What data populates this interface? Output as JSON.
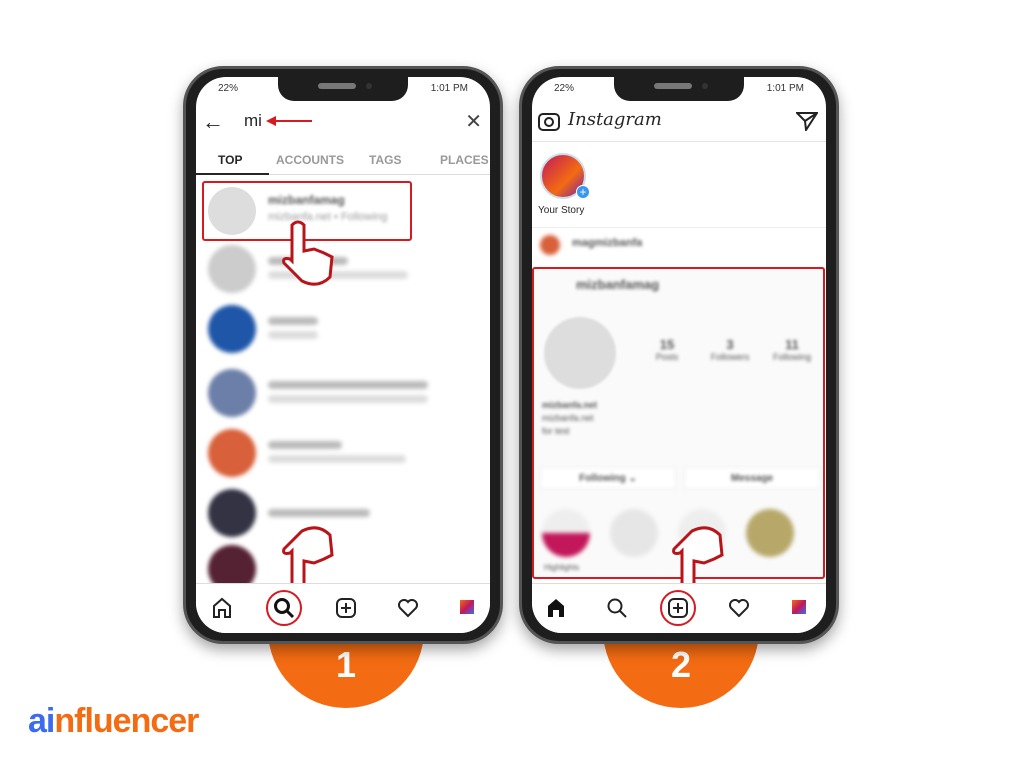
{
  "step1": {
    "number": "1",
    "status": {
      "battery": "22%",
      "time": "1:01 PM"
    },
    "search": {
      "value": "mi"
    },
    "tabs": [
      {
        "label": "TOP",
        "active": true
      },
      {
        "label": "ACCOUNTS"
      },
      {
        "label": "TAGS"
      },
      {
        "label": "PLACES"
      }
    ],
    "results": [
      {
        "name": "mizbanfamag",
        "sub": "mizbanfa.net • Following"
      }
    ],
    "nav": [
      "home-icon",
      "search-icon",
      "add-post-icon",
      "heart-icon",
      "profile-icon"
    ]
  },
  "step2": {
    "number": "2",
    "status": {
      "battery": "22%",
      "time": "1:01 PM"
    },
    "app_title": "Instagram",
    "story_label": "Your Story",
    "feed_account": "magmizbanfa",
    "profile": {
      "username": "mizbanfamag",
      "posts": "15",
      "posts_label": "Posts",
      "followers": "3",
      "followers_label": "Followers",
      "following": "11",
      "following_label": "Following",
      "bio": [
        "mizbanfa.net",
        "mizbanfa.net",
        "for test"
      ],
      "following_button": "Following ⌄",
      "message_button": "Message",
      "highlight_label": "Highlights"
    },
    "nav": [
      "home-icon",
      "search-icon",
      "add-post-icon",
      "heart-icon",
      "profile-icon"
    ]
  },
  "brand": {
    "logo_a": "ai",
    "logo_b": "nfluencer",
    "accent": "#f36b12",
    "blue": "#3b6cf0",
    "highlight_red": "#d71920"
  }
}
